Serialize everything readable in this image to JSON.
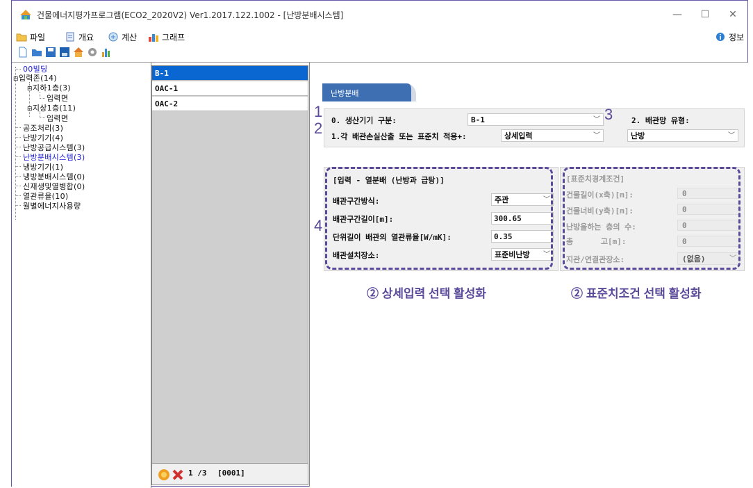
{
  "window": {
    "title": "건물에너지평가프로그램(ECO2_2020V2) Ver1.2017.122.1002 - [난방분배시스템]",
    "minimize": "—",
    "maximize": "☐",
    "close": "✕"
  },
  "menu": {
    "file": "파일",
    "overview": "개요",
    "calc": "계산",
    "graph": "그래프",
    "info": "정보"
  },
  "tree": {
    "building": "00빌딩",
    "input_zone": "입력존(14)",
    "basement": "지하1층(3)",
    "basement_input": "입력면",
    "ground": "지상1층(11)",
    "ground_input": "입력면",
    "air_handling": "공조처리(3)",
    "heating_equipment": "난방기기(4)",
    "heating_supply": "난방공급시스템(3)",
    "heating_distribution": "난방분배시스템(3)",
    "cooling_equipment": "냉방기기(1)",
    "cooling_distribution": "냉방분배시스템(0)",
    "renewable": "신재생및열병합(0)",
    "heat_flow": "열관류율(10)",
    "monthly_energy": "월별에너지사용량"
  },
  "list": {
    "items": [
      "B-1",
      "OAC-1",
      "OAC-2"
    ],
    "page": "1 /3",
    "code": "[0001]"
  },
  "panel": {
    "tab_label": "난방분배",
    "gen_label": "0. 생산기기 구분:",
    "gen_value": "B-1",
    "pipe_type_label": "2. 배관망 유형:",
    "pipe_type_value": "난방",
    "method_label": "1.각 배관손실산출 또는 표준치 적용+:",
    "method_value": "상세입력",
    "detail": {
      "title": "[입력 - 열분배 (난방과 급탕)]",
      "section_label": "배관구간방식:",
      "section_value": "주관",
      "length_label": "배관구간길이[m]:",
      "length_value": "300.65",
      "loss_label": "단위길이 배관의 열관류율[W/mK]:",
      "loss_value": "0.35",
      "location_label": "배관설치장소:",
      "location_value": "표준비난방"
    },
    "standard": {
      "title": "[표준치경계조건]",
      "length_x_label": "건물길이(x축)[m]:",
      "length_x_value": "0",
      "width_y_label": "건물너비(y축)[m]:",
      "width_y_value": "0",
      "floors_label": "난방을하는 층의 수:",
      "floors_value": "0",
      "height_label": "총      고[m]:",
      "height_value": "0",
      "connection_label": "지관/연결관장소:",
      "connection_value": "(없음)"
    }
  },
  "annotations": {
    "n1": "1",
    "n2": "2",
    "n3": "3",
    "n4": "4",
    "caption_detail": "② 상세입력 선택 활성화",
    "caption_standard": "② 표준치조건 선택 활성화",
    "color": "#5b4a9a"
  }
}
